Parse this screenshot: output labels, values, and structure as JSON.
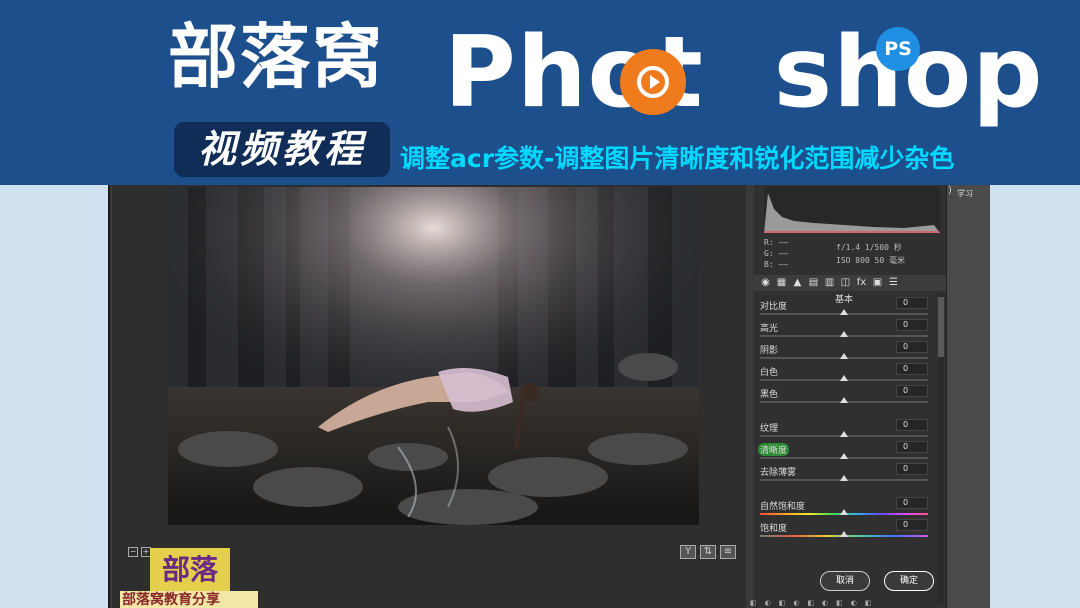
{
  "banner": {
    "logo": "部落窝",
    "badge": "视频教程",
    "product_prefix": "Phot",
    "product_suffix": "shop",
    "ps_badge": "PS",
    "subtitle": "调整acr参数-调整图片清晰度和锐化范围减少杂色",
    "colors": {
      "background": "#1c4f8b",
      "subtitle": "#00d8ff",
      "accent": "#f07b1c"
    }
  },
  "camera_raw": {
    "readout": {
      "r_label": "R:",
      "g_label": "G:",
      "b_label": "B:",
      "r_value": "——",
      "g_value": "——",
      "b_value": "——",
      "exif_line1": "f/1.4  1/500 秒",
      "exif_line2": "ISO 800  50 毫米"
    },
    "tool_icons": [
      "camera-icon",
      "grid-icon",
      "mountain-icon",
      "split-icon",
      "bars-icon",
      "lens-icon",
      "fx-icon",
      "calibration-icon",
      "presets-icon"
    ],
    "tool_glyphs": [
      "◉",
      "▦",
      "▲",
      "▤",
      "▥",
      "◫",
      "fx",
      "▣",
      "☰"
    ],
    "section_title": "基本",
    "sliders": [
      {
        "label": "对比度",
        "value": "0",
        "position": 0.5
      },
      {
        "label": "高光",
        "value": "0",
        "position": 0.5
      },
      {
        "label": "阴影",
        "value": "0",
        "position": 0.5
      },
      {
        "label": "白色",
        "value": "0",
        "position": 0.5
      },
      {
        "label": "黑色",
        "value": "0",
        "position": 0.5
      },
      {
        "label": "纹理",
        "value": "0",
        "position": 0.5
      },
      {
        "label": "清晰度",
        "value": "0",
        "position": 0.5
      },
      {
        "label": "去除薄雾",
        "value": "0",
        "position": 0.5
      },
      {
        "label": "自然饱和度",
        "value": "0",
        "position": 0.5
      },
      {
        "label": "饱和度",
        "value": "0",
        "position": 0.5
      }
    ],
    "preview_buttons": {
      "zoom_out": "−",
      "zoom_in": "+",
      "compare": "Y"
    },
    "cancel_label": "取消",
    "ok_label": "确定",
    "side_label": "学习"
  },
  "watermark": {
    "logo": "部落窝",
    "share": "部落窝教育分享"
  }
}
